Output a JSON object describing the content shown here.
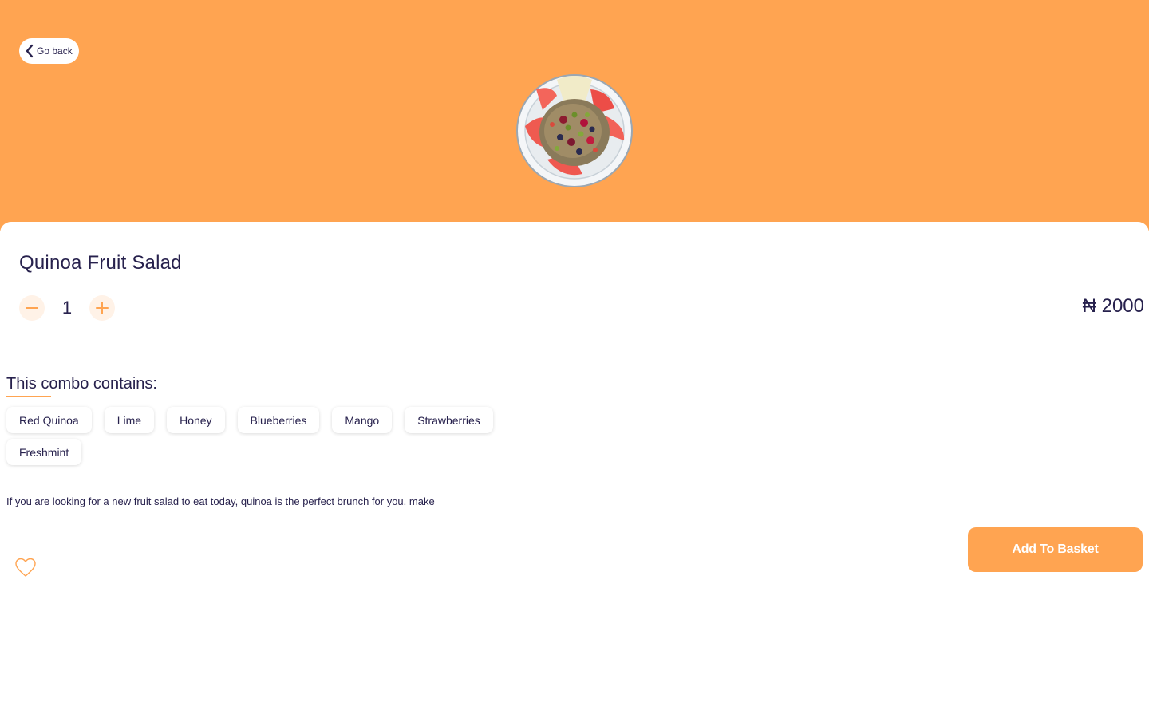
{
  "colors": {
    "accent": "#ffa451",
    "text": "#27214d",
    "button_soft": "#fff2e7"
  },
  "header": {
    "back_label": "Go back",
    "back_icon": "chevron-left-icon",
    "product_image": "quinoa-fruit-salad-plate"
  },
  "product": {
    "name": "Quinoa Fruit Salad",
    "quantity": "1",
    "price": "₦ 2000",
    "decrease_icon": "minus-icon",
    "increase_icon": "plus-icon"
  },
  "combo": {
    "heading": "This combo contains:",
    "items": [
      "Red Quinoa",
      "Lime",
      "Honey",
      "Blueberries",
      "Mango",
      "Strawberries",
      "Freshmint"
    ]
  },
  "description": "If you are looking for a new fruit salad to eat today, quinoa is the perfect brunch for you. make",
  "actions": {
    "favorite_icon": "heart-icon",
    "add_to_basket": "Add To Basket"
  }
}
